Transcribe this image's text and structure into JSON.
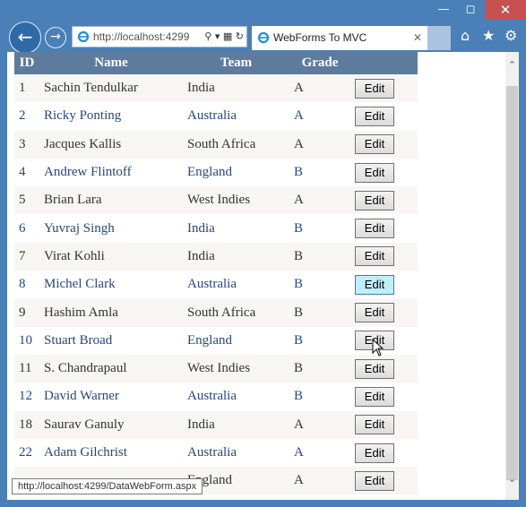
{
  "browser": {
    "address_url": "http://localhost:4299",
    "tab_title": "WebForms To MVC",
    "status_url": "http://localhost:4299/DataWebForm.aspx"
  },
  "icons": {
    "back": "back-arrow-icon",
    "forward": "forward-arrow-icon",
    "home": "home-icon",
    "favorites": "star-icon",
    "settings": "gear-icon"
  },
  "colors": {
    "header_bg": "#5d7b9d",
    "alt_row_bg": "#f7f6f3",
    "link_text": "#284775",
    "chrome": "#4a7fb7"
  },
  "grid": {
    "columns": [
      "ID",
      "Name",
      "Team",
      "Grade"
    ],
    "edit_label": "Edit",
    "rows": [
      {
        "id": "1",
        "name": "Sachin Tendulkar",
        "team": "India",
        "grade": "A"
      },
      {
        "id": "2",
        "name": "Ricky Ponting",
        "team": "Australia",
        "grade": "A"
      },
      {
        "id": "3",
        "name": "Jacques Kallis",
        "team": "South Africa",
        "grade": "A"
      },
      {
        "id": "4",
        "name": "Andrew Flintoff",
        "team": "England",
        "grade": "B"
      },
      {
        "id": "5",
        "name": "Brian Lara",
        "team": "West Indies",
        "grade": "A"
      },
      {
        "id": "6",
        "name": "Yuvraj Singh",
        "team": "India",
        "grade": "B"
      },
      {
        "id": "7",
        "name": "Virat Kohli",
        "team": "India",
        "grade": "B"
      },
      {
        "id": "8",
        "name": "Michel Clark",
        "team": "Australia",
        "grade": "B"
      },
      {
        "id": "9",
        "name": "Hashim Amla",
        "team": "South Africa",
        "grade": "B"
      },
      {
        "id": "10",
        "name": "Stuart Broad",
        "team": "England",
        "grade": "B"
      },
      {
        "id": "11",
        "name": "S. Chandrapaul",
        "team": "West Indies",
        "grade": "B"
      },
      {
        "id": "12",
        "name": "David Warner",
        "team": "Australia",
        "grade": "B"
      },
      {
        "id": "18",
        "name": "Saurav Ganuly",
        "team": "India",
        "grade": "A"
      },
      {
        "id": "22",
        "name": "Adam Gilchrist",
        "team": "Australia",
        "grade": "A"
      },
      {
        "id": "",
        "name": "",
        "team": "England",
        "grade": "A"
      }
    ]
  }
}
